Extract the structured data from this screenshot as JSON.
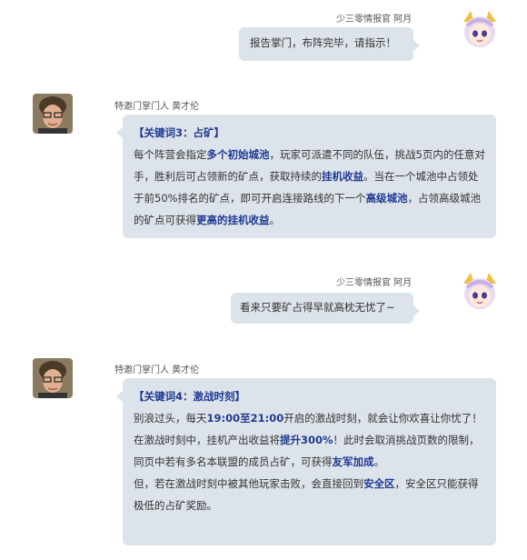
{
  "msg1": {
    "sender": "少三零情报官  阿月",
    "text": "报告掌门，布阵完毕，请指示！"
  },
  "msg2": {
    "sender": "特邀门掌门人  黄才伦",
    "heading": "【关键词3：占矿】",
    "p1_a": "每个阵营会指定",
    "p1_b": "多个初始城池",
    "p1_c": "，玩家可派遣不同的队伍，挑战5页内的任意对手，胜利后可占领新的矿点，获取持续的",
    "p1_d": "挂机收益",
    "p1_e": "。当在一个城池中占领处于前50%排名的矿点，即可开启连接路线的下一个",
    "p1_f": "高级城池",
    "p1_g": "，占领高级城池的矿点可获得",
    "p1_h": "更高的挂机收益",
    "p1_i": "。"
  },
  "msg3": {
    "sender": "少三零情报官  阿月",
    "text": "看来只要矿占得早就高枕无忧了~"
  },
  "msg4": {
    "sender": "特邀门掌门人  黄才伦",
    "heading": "【关键词4：激战时刻】",
    "p1_a": "别浪过头，每天",
    "p1_b": "19:00至21:00",
    "p1_c": "开启的激战时刻，就会让你欢喜让你忧了！",
    "p2_a": "在激战时刻中，挂机产出收益将",
    "p2_b": "提升300%",
    "p2_c": "！此时会取消挑战页数的限制，同页中若有多名本联盟的成员占矿，可获得",
    "p2_d": "友军加成",
    "p2_e": "。",
    "p3_a": "但，若在激战时刻中被其他玩家击败，会直接回到",
    "p3_b": "安全区",
    "p3_c": "，安全区只能获得极低的占矿奖励。"
  }
}
